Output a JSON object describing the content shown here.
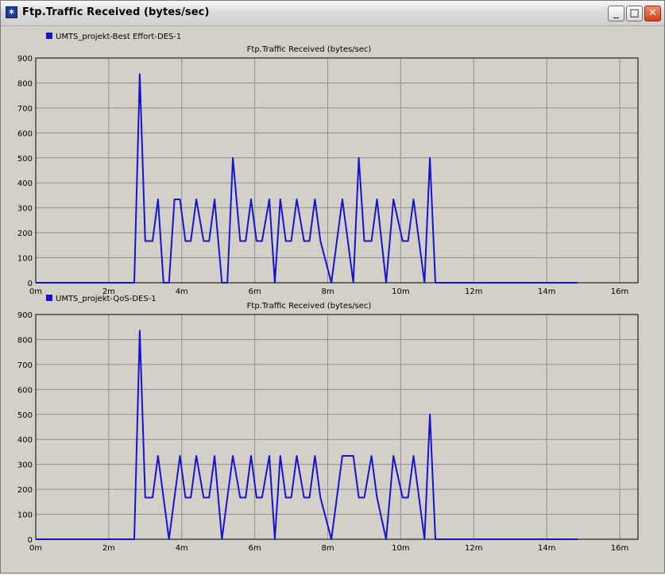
{
  "window": {
    "title": "Ftp.Traffic Received (bytes/sec)",
    "buttons": {
      "minimize": "_",
      "maximize": "□",
      "close": "✕"
    },
    "icon": "app-star-icon"
  },
  "colors": {
    "series": "#1414d2",
    "plot_bg": "#d4d0c8",
    "grid": "#8f8f8f",
    "legend": "#1414d2"
  },
  "chart_data": [
    {
      "type": "line",
      "title": "Ftp.Traffic Received (bytes/sec)",
      "legend": "UMTS_projekt-Best Effort-DES-1",
      "series": [
        {
          "name": "UMTS_projekt-Best Effort-DES-1",
          "x_min": [
            0,
            2.7,
            2.85,
            3.0,
            3.2,
            3.35,
            3.5,
            3.65,
            3.8,
            3.95,
            4.1,
            4.25,
            4.4,
            4.6,
            4.75,
            4.9,
            5.1,
            5.25,
            5.4,
            5.6,
            5.75,
            5.9,
            6.05,
            6.2,
            6.4,
            6.55,
            6.7,
            6.85,
            7.0,
            7.15,
            7.35,
            7.5,
            7.65,
            7.8,
            8.1,
            8.4,
            8.7,
            8.85,
            9.0,
            9.2,
            9.35,
            9.6,
            9.8,
            10.05,
            10.2,
            10.35,
            10.65,
            10.8,
            10.95,
            14.85
          ],
          "y": [
            0,
            0,
            835,
            167,
            167,
            334,
            0,
            0,
            334,
            334,
            167,
            167,
            334,
            167,
            167,
            334,
            0,
            0,
            500,
            167,
            167,
            334,
            167,
            167,
            334,
            0,
            334,
            167,
            167,
            334,
            167,
            167,
            334,
            167,
            0,
            334,
            0,
            500,
            167,
            167,
            334,
            0,
            334,
            167,
            167,
            334,
            0,
            500,
            0,
            0
          ]
        }
      ],
      "x_ticks": [
        "0m",
        "2m",
        "4m",
        "6m",
        "8m",
        "10m",
        "12m",
        "14m",
        "16m"
      ],
      "y_ticks": [
        "0",
        "100",
        "200",
        "300",
        "400",
        "500",
        "600",
        "700",
        "800",
        "900"
      ],
      "xlim": [
        0,
        16.5
      ],
      "ylim": [
        0,
        900
      ],
      "grid": true
    },
    {
      "type": "line",
      "title": "Ftp.Traffic Received (bytes/sec)",
      "legend": "UMTS_projekt-QoS-DES-1",
      "series": [
        {
          "name": "UMTS_projekt-QoS-DES-1",
          "x_min": [
            0,
            2.7,
            2.85,
            3.0,
            3.2,
            3.35,
            3.65,
            3.95,
            4.1,
            4.25,
            4.4,
            4.6,
            4.75,
            4.9,
            5.1,
            5.4,
            5.6,
            5.75,
            5.9,
            6.05,
            6.2,
            6.4,
            6.55,
            6.7,
            6.85,
            7.0,
            7.15,
            7.35,
            7.5,
            7.65,
            7.8,
            8.1,
            8.4,
            8.7,
            8.85,
            9.0,
            9.2,
            9.35,
            9.6,
            9.8,
            10.05,
            10.2,
            10.35,
            10.65,
            10.8,
            10.95,
            14.85
          ],
          "y": [
            0,
            0,
            835,
            167,
            167,
            334,
            0,
            334,
            167,
            167,
            334,
            167,
            167,
            334,
            0,
            334,
            167,
            167,
            334,
            167,
            167,
            334,
            0,
            334,
            167,
            167,
            334,
            167,
            167,
            334,
            167,
            0,
            334,
            334,
            167,
            167,
            334,
            167,
            0,
            334,
            167,
            167,
            334,
            0,
            500,
            0,
            0
          ]
        }
      ],
      "x_ticks": [
        "0m",
        "2m",
        "4m",
        "6m",
        "8m",
        "10m",
        "12m",
        "14m",
        "16m"
      ],
      "y_ticks": [
        "0",
        "100",
        "200",
        "300",
        "400",
        "500",
        "600",
        "700",
        "800",
        "900"
      ],
      "xlim": [
        0,
        16.5
      ],
      "ylim": [
        0,
        900
      ],
      "grid": true
    }
  ]
}
